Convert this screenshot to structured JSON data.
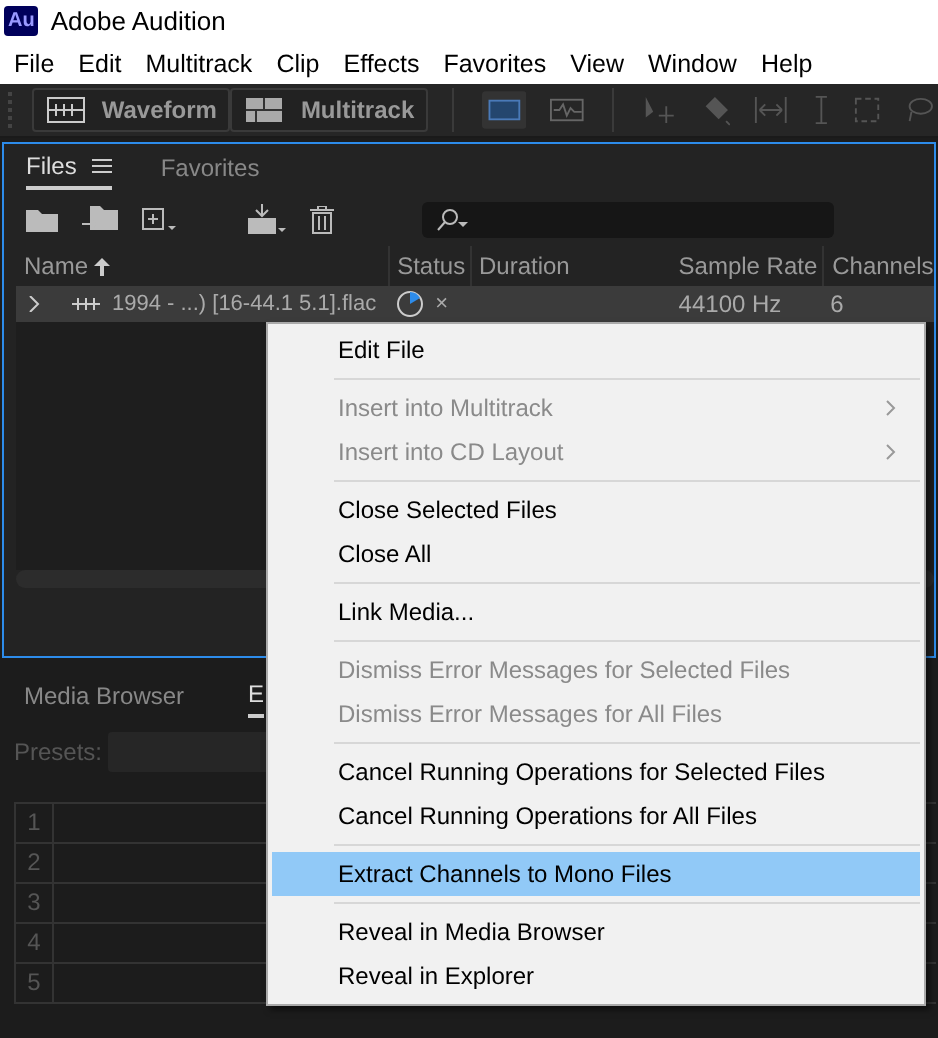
{
  "window": {
    "title": "Adobe Audition",
    "app_badge": "Au"
  },
  "menu_bar": [
    "File",
    "Edit",
    "Multitrack",
    "Clip",
    "Effects",
    "Favorites",
    "View",
    "Window",
    "Help"
  ],
  "mode_buttons": [
    {
      "label": "Waveform",
      "kind": "waveform"
    },
    {
      "label": "Multitrack",
      "kind": "multitrack"
    }
  ],
  "files_panel": {
    "tabs": [
      {
        "label": "Files",
        "selected": true
      },
      {
        "label": "Favorites",
        "selected": false
      }
    ],
    "columns": [
      "Name",
      "Status",
      "Duration",
      "Sample Rate",
      "Channels"
    ],
    "rows": [
      {
        "name": "1994 - ...) [16-44.1 5.1].flac",
        "status": "×",
        "sample_rate": "44100 Hz",
        "channels": "6",
        "selected": true
      }
    ]
  },
  "bottom_panel": {
    "tabs": [
      {
        "label": "Media Browser",
        "selected": false
      },
      {
        "label": "E",
        "selected": true
      }
    ],
    "presets_label": "Presets:",
    "row_numbers": [
      "1",
      "2",
      "3",
      "4",
      "5"
    ]
  },
  "context_menu": [
    {
      "kind": "item",
      "label": "Edit File",
      "disabled": false,
      "selected": false,
      "submenu": false
    },
    {
      "kind": "separator"
    },
    {
      "kind": "item",
      "label": "Insert into Multitrack",
      "disabled": true,
      "selected": false,
      "submenu": true
    },
    {
      "kind": "item",
      "label": "Insert into CD Layout",
      "disabled": true,
      "selected": false,
      "submenu": true
    },
    {
      "kind": "separator"
    },
    {
      "kind": "item",
      "label": "Close Selected Files",
      "disabled": false,
      "selected": false,
      "submenu": false
    },
    {
      "kind": "item",
      "label": "Close All",
      "disabled": false,
      "selected": false,
      "submenu": false
    },
    {
      "kind": "separator"
    },
    {
      "kind": "item",
      "label": "Link Media...",
      "disabled": false,
      "selected": false,
      "submenu": false
    },
    {
      "kind": "separator"
    },
    {
      "kind": "item",
      "label": "Dismiss Error Messages for Selected Files",
      "disabled": true,
      "selected": false,
      "submenu": false
    },
    {
      "kind": "item",
      "label": "Dismiss Error Messages for All Files",
      "disabled": true,
      "selected": false,
      "submenu": false
    },
    {
      "kind": "separator"
    },
    {
      "kind": "item",
      "label": "Cancel Running Operations for Selected Files",
      "disabled": false,
      "selected": false,
      "submenu": false
    },
    {
      "kind": "item",
      "label": "Cancel Running Operations for All Files",
      "disabled": false,
      "selected": false,
      "submenu": false
    },
    {
      "kind": "separator"
    },
    {
      "kind": "item",
      "label": "Extract Channels to Mono Files",
      "disabled": false,
      "selected": true,
      "submenu": false
    },
    {
      "kind": "separator"
    },
    {
      "kind": "item",
      "label": "Reveal in Media Browser",
      "disabled": false,
      "selected": false,
      "submenu": false
    },
    {
      "kind": "item",
      "label": "Reveal in Explorer",
      "disabled": false,
      "selected": false,
      "submenu": false
    }
  ]
}
